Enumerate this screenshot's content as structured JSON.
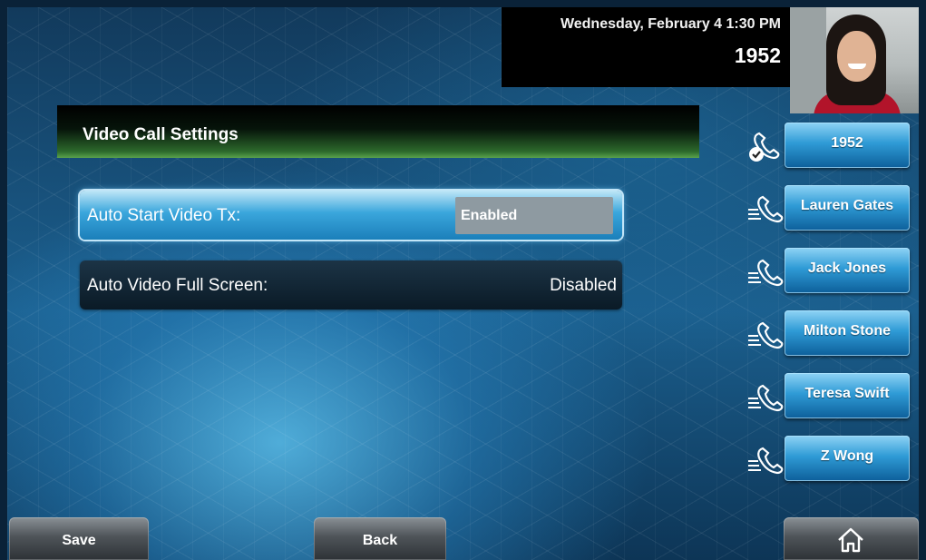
{
  "status": {
    "datetime": "Wednesday, February 4  1:30 PM",
    "extension": "1952"
  },
  "video_preview": {
    "description": "self-view-camera"
  },
  "page": {
    "title": "Video Call Settings"
  },
  "settings": [
    {
      "label": "Auto Start Video Tx:",
      "value": "Enabled",
      "selected": true
    },
    {
      "label": "Auto Video Full Screen:",
      "value": "Disabled",
      "selected": false
    }
  ],
  "lines": [
    {
      "label": "1952",
      "icon": "registered-line-icon"
    },
    {
      "label": "Lauren Gates",
      "icon": "speed-dial-icon"
    },
    {
      "label": "Jack Jones",
      "icon": "speed-dial-icon"
    },
    {
      "label": "Milton Stone",
      "icon": "speed-dial-icon"
    },
    {
      "label": "Teresa Swift",
      "icon": "speed-dial-icon"
    },
    {
      "label": "Z Wong",
      "icon": "speed-dial-icon"
    }
  ],
  "softkeys": {
    "save": "Save",
    "back": "Back",
    "home_icon": "home-icon"
  },
  "colors": {
    "accent_blue": "#2f9bd6",
    "title_green": "#5aa24c",
    "selected_value_bg": "#8e9aa1"
  }
}
